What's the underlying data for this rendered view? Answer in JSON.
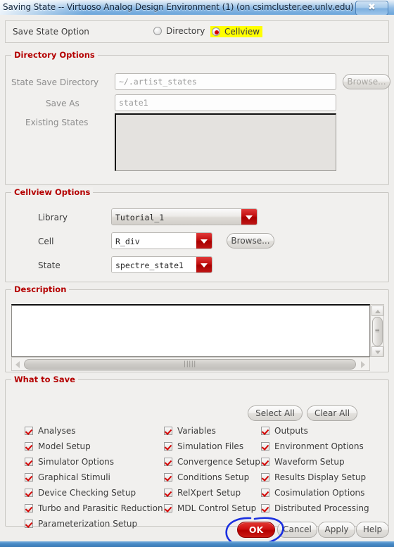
{
  "window": {
    "title": "Saving State -- Virtuoso Analog Design Environment (1) (on csimcluster.ee.unlv.edu)",
    "close_label": "✖"
  },
  "save_state_option": {
    "label": "Save State Option",
    "options": [
      {
        "label": "Directory",
        "selected": false
      },
      {
        "label": "Cellview",
        "selected": true,
        "highlighted": true
      }
    ]
  },
  "directory_options": {
    "title": "Directory Options",
    "state_save_directory_label": "State Save Directory",
    "state_save_directory_value": "~/.artist_states",
    "browse_label": "Browse...",
    "save_as_label": "Save As",
    "save_as_value": "state1",
    "existing_states_label": "Existing States",
    "existing_states_items": []
  },
  "cellview_options": {
    "title": "Cellview Options",
    "library_label": "Library",
    "library_value": "Tutorial_1",
    "cell_label": "Cell",
    "cell_value": "R_div",
    "browse_label": "Browse...",
    "state_label": "State",
    "state_value": "spectre_state1"
  },
  "description": {
    "title": "Description",
    "value": ""
  },
  "what_to_save": {
    "title": "What to Save",
    "select_all_label": "Select All",
    "clear_all_label": "Clear All",
    "columns": [
      [
        {
          "label": "Analyses",
          "checked": true
        },
        {
          "label": "Model Setup",
          "checked": true
        },
        {
          "label": "Simulator Options",
          "checked": true
        },
        {
          "label": "Graphical Stimuli",
          "checked": true
        },
        {
          "label": "Device Checking Setup",
          "checked": true
        },
        {
          "label": "Turbo and Parasitic Reduction",
          "checked": true
        },
        {
          "label": "Parameterization Setup",
          "checked": true
        }
      ],
      [
        {
          "label": "Variables",
          "checked": true
        },
        {
          "label": "Simulation Files",
          "checked": true
        },
        {
          "label": "Convergence Setup",
          "checked": true
        },
        {
          "label": "Conditions Setup",
          "checked": true
        },
        {
          "label": "RelXpert Setup",
          "checked": true
        },
        {
          "label": "MDL Control Setup",
          "checked": true
        }
      ],
      [
        {
          "label": "Outputs",
          "checked": true
        },
        {
          "label": "Environment Options",
          "checked": true
        },
        {
          "label": "Waveform Setup",
          "checked": true
        },
        {
          "label": "Results Display Setup",
          "checked": true
        },
        {
          "label": "Cosimulation Options",
          "checked": true
        },
        {
          "label": "Distributed Processing",
          "checked": true
        }
      ]
    ]
  },
  "footer": {
    "ok_label": "OK",
    "cancel_label": "Cancel",
    "apply_label": "Apply",
    "help_label": "Help"
  },
  "colors": {
    "group_title": "#b40000",
    "accent_red": "#c10e0e",
    "highlight_yellow": "#ffff00",
    "annotation_blue": "#1a2fe0",
    "titlebar_blue": "#8fbbe4"
  }
}
